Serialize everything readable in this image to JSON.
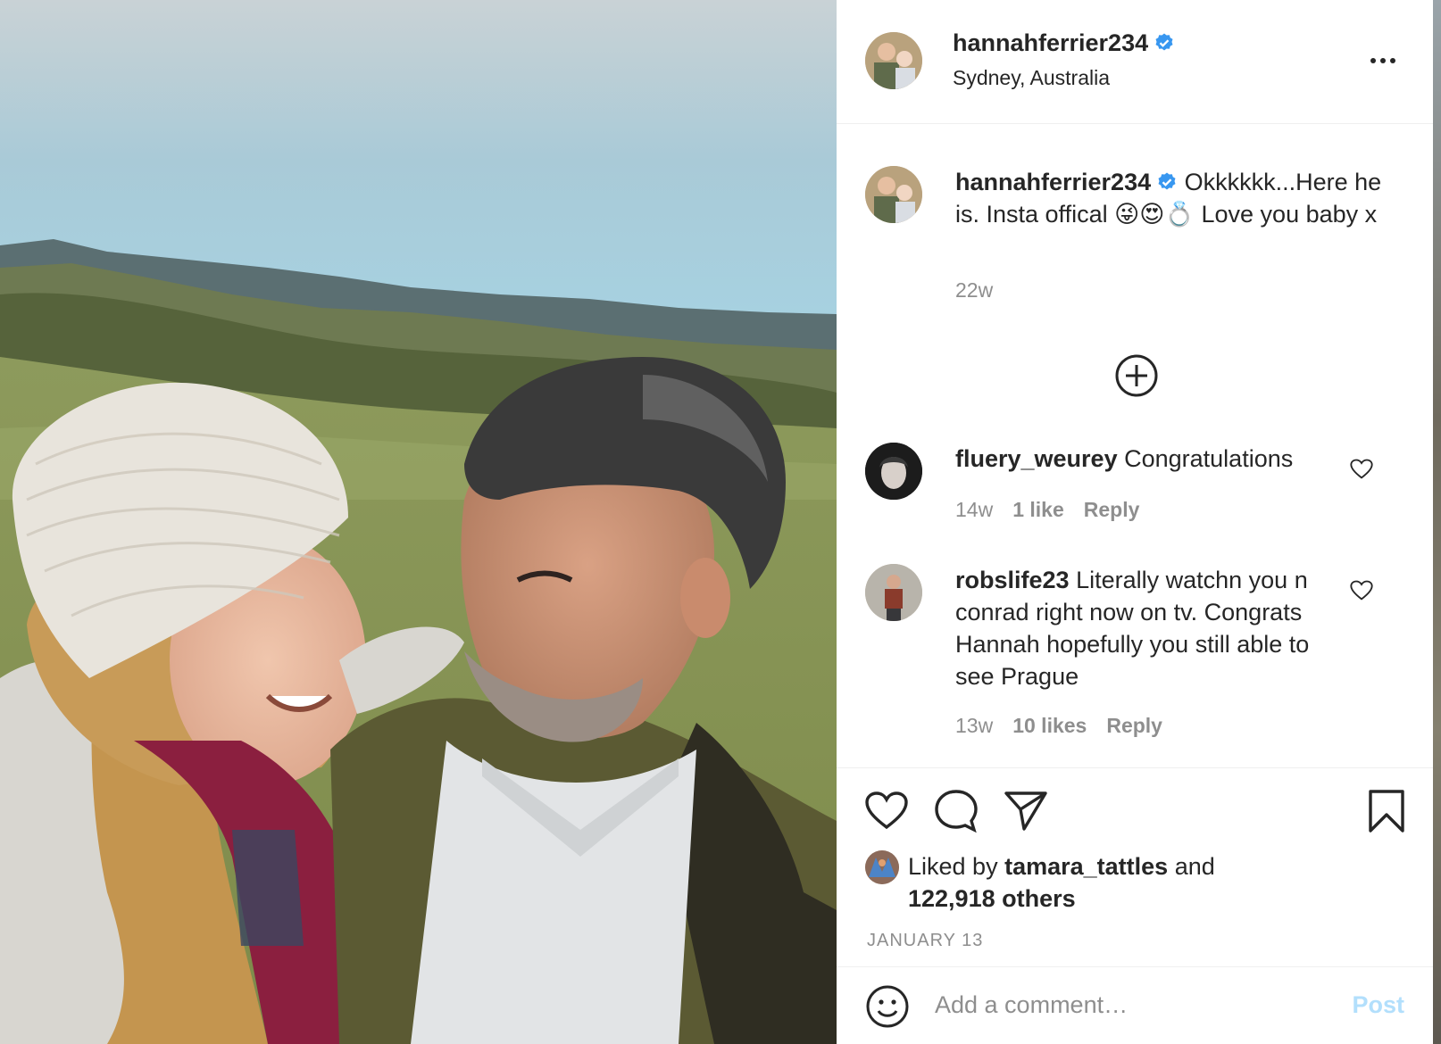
{
  "post": {
    "username": "hannahferrier234",
    "location": "Sydney, Australia",
    "verified": true,
    "caption": "Okkkkkk...Here he is. Insta offical 😜😍💍 Love you baby x",
    "caption_age": "22w",
    "likes_by_user": "tamara_tattles",
    "likes_by_prefix": "Liked by",
    "likes_and": "and",
    "likes_others": "122,918 others",
    "date": "JANUARY 13"
  },
  "comments": [
    {
      "username": "fluery_weurey",
      "text": "Congratulations",
      "age": "14w",
      "likes": "1 like",
      "reply": "Reply"
    },
    {
      "username": "robslife23",
      "text": "Literally watchn you n conrad right now on tv. Congrats Hannah hopefully you still able to see Prague",
      "age": "13w",
      "likes": "10 likes",
      "reply": "Reply"
    }
  ],
  "comment_box": {
    "placeholder": "Add a comment…",
    "post_label": "Post"
  },
  "icons": {
    "more": "more-options-icon",
    "load_more": "load-more-comments-icon",
    "like": "heart-icon",
    "comment": "comment-bubble-icon",
    "share": "send-paper-plane-icon",
    "save": "bookmark-icon",
    "emoji": "emoji-smiley-icon"
  },
  "colors": {
    "verified_blue": "#3897f0",
    "post_disabled": "#b2dffc",
    "meta_gray": "#8e8e8e"
  }
}
